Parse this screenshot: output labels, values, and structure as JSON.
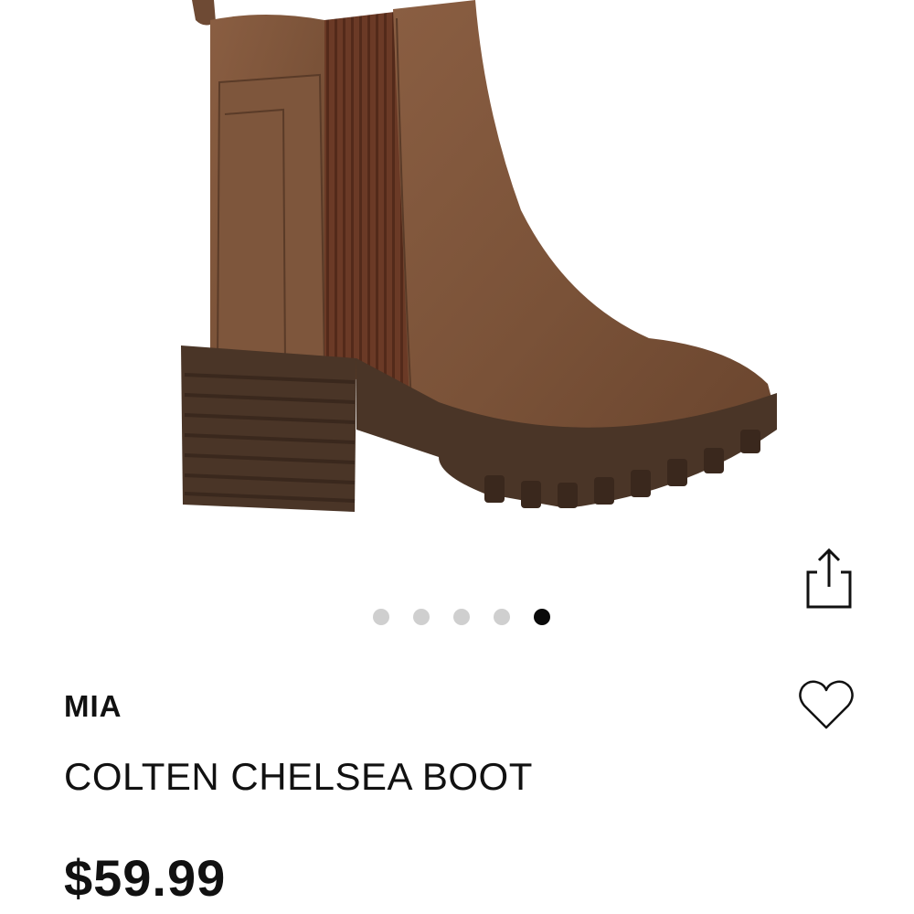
{
  "product": {
    "brand": "MIA",
    "name": "COLTEN CHELSEA BOOT",
    "price": "$59.99"
  },
  "product_image": {
    "subject": "brown chelsea boot",
    "boot_color": "#7a5238",
    "sole_color": "#4a3527",
    "elastic_color": "#6b3a26"
  },
  "carousel": {
    "total_images": 5,
    "active_index": 4
  },
  "icons": {
    "share": "share-icon",
    "favorite": "heart-icon"
  }
}
